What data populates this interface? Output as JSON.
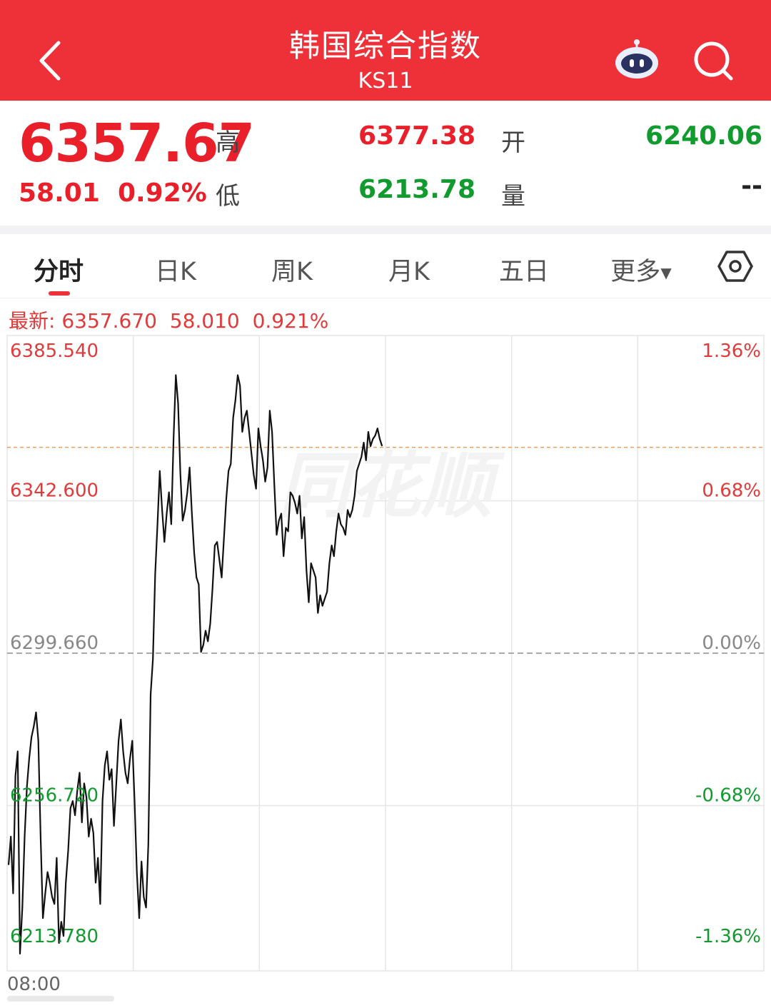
{
  "header": {
    "title": "韩国综合指数",
    "code": "KS11",
    "bg_color": "#ee3139"
  },
  "quote": {
    "price": "6357.67",
    "change": "58.01",
    "change_pct": "0.92%",
    "high_label": "高",
    "high": "6377.38",
    "open_label": "开",
    "open": "6240.06",
    "low_label": "低",
    "low": "6213.78",
    "volume_label": "量",
    "volume": "--"
  },
  "tabs": [
    {
      "label": "分时",
      "active": true
    },
    {
      "label": "日K"
    },
    {
      "label": "周K"
    },
    {
      "label": "月K"
    },
    {
      "label": "五日"
    },
    {
      "label": "更多"
    }
  ],
  "latest": {
    "label": "最新:",
    "price": "6357.670",
    "change": "58.010",
    "pct": "0.921%"
  },
  "chart_data": {
    "type": "line",
    "xlabels": [
      "08:00"
    ],
    "ylim": [
      6213.78,
      6385.54
    ],
    "yticks": [
      {
        "value": "6385.540",
        "pct": "1.36%",
        "color": "#e23a3a"
      },
      {
        "value": "6342.600",
        "pct": "0.68%",
        "color": "#e23a3a"
      },
      {
        "value": "6299.660",
        "pct": "0.00%",
        "color": "#888888"
      },
      {
        "value": "6256.720",
        "pct": "-0.68%",
        "color": "#119a2e"
      },
      {
        "value": "6213.780",
        "pct": "-1.36%",
        "color": "#119a2e"
      }
    ],
    "prev_close": 6299.66,
    "latest_price": 6357.67,
    "total_points": 330,
    "values": [
      6240,
      6248,
      6232,
      6265,
      6272,
      6215,
      6228,
      6248,
      6262,
      6270,
      6276,
      6279,
      6283,
      6275,
      6248,
      6225,
      6232,
      6238,
      6235,
      6231,
      6229,
      6242,
      6218,
      6224,
      6220,
      6235,
      6244,
      6256,
      6258,
      6254,
      6261,
      6266,
      6252,
      6263,
      6259,
      6248,
      6253,
      6249,
      6235,
      6242,
      6229,
      6258,
      6268,
      6272,
      6264,
      6267,
      6251,
      6263,
      6275,
      6281,
      6272,
      6266,
      6263,
      6270,
      6275,
      6258,
      6238,
      6225,
      6241,
      6231,
      6228,
      6246,
      6288,
      6298,
      6322,
      6336,
      6351,
      6340,
      6331,
      6339,
      6345,
      6336,
      6360,
      6378,
      6370,
      6350,
      6337,
      6340,
      6345,
      6352,
      6339,
      6328,
      6321,
      6319,
      6300,
      6302,
      6306,
      6303,
      6308,
      6318,
      6330,
      6331,
      6326,
      6321,
      6332,
      6343,
      6351,
      6353,
      6366,
      6371,
      6378,
      6375,
      6362,
      6366,
      6368,
      6362,
      6356,
      6350,
      6346,
      6363,
      6358,
      6354,
      6348,
      6352,
      6368,
      6362,
      6347,
      6333,
      6337,
      6339,
      6327,
      6335,
      6334,
      6345,
      6344,
      6342,
      6339,
      6344,
      6332,
      6338,
      6323,
      6314,
      6325,
      6323,
      6321,
      6311,
      6316,
      6313,
      6315,
      6317,
      6325,
      6330,
      6327,
      6334,
      6339,
      6336,
      6335,
      6333,
      6340,
      6338,
      6340,
      6344,
      6351,
      6353,
      6355,
      6359,
      6354,
      6362,
      6358,
      6360,
      6361,
      6363,
      6360,
      6358
    ],
    "line_color": "#111111",
    "grid_color": "#e6e6e6"
  }
}
